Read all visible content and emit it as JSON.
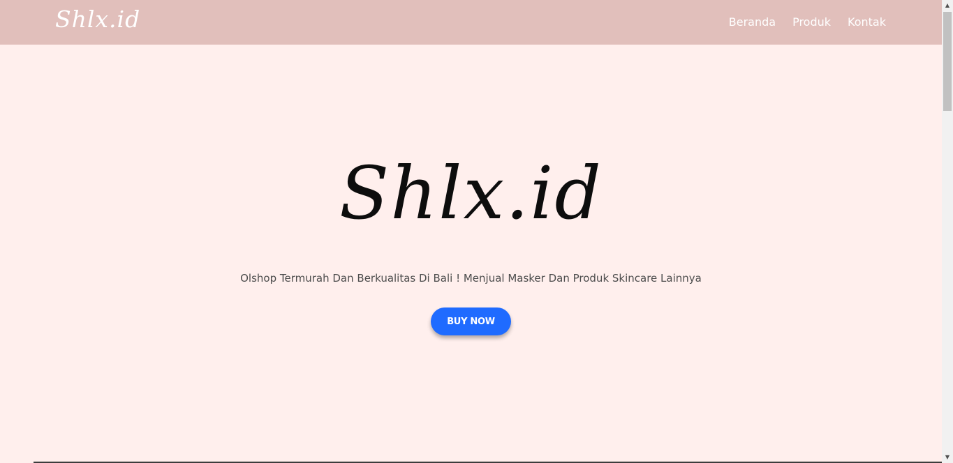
{
  "navbar": {
    "logo": "Shlx.id",
    "links": [
      "Beranda",
      "Produk",
      "Kontak"
    ],
    "background": "#e1bfbb"
  },
  "hero": {
    "title": "Shlx.id",
    "tagline": "Olshop Termurah Dan Berkualitas Di Bali ! Menjual Masker Dan Produk Skincare Lainnya",
    "button_label": "BUY NOW",
    "background": "#ffefed",
    "button_color": "#1f6bff"
  },
  "scrollbar": {
    "up_icon": "chevron-up-icon",
    "down_icon": "chevron-down-icon"
  }
}
